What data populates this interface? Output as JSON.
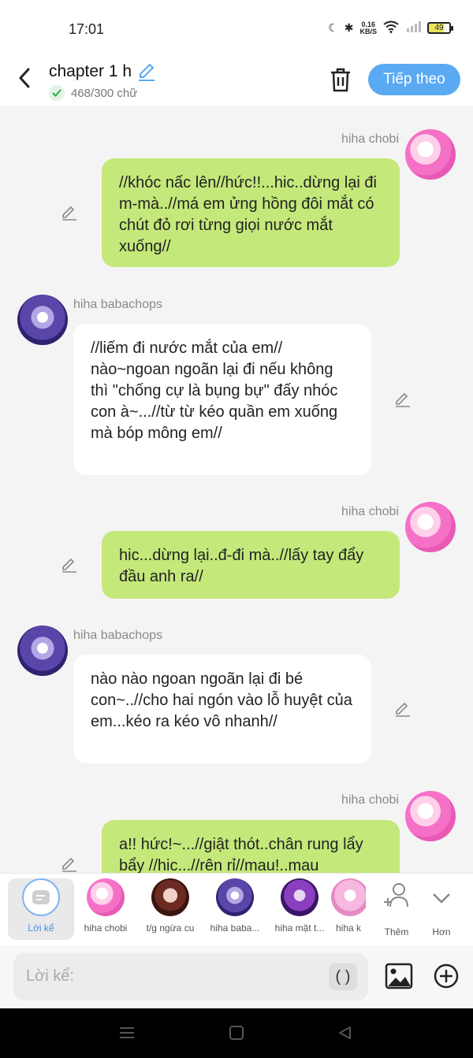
{
  "status": {
    "time": "17:01",
    "net_speed_value": "0.16",
    "net_speed_unit": "KB/S",
    "battery": "49"
  },
  "header": {
    "title": "chapter 1 h",
    "word_count": "468/300 chữ",
    "next_label": "Tiếp theo"
  },
  "messages": [
    {
      "sender": "hiha chobi",
      "side": "right",
      "text": "//khóc nấc lên//hức!!...hic..dừng lại đi m-mà..//má em ửng hồng đôi mắt có chút đỏ rơi từng giọi nước mắt xuống//"
    },
    {
      "sender": "hiha babachops",
      "side": "left",
      "text": "//liếm đi nước mắt của em// nào~ngoan ngoãn lại đi nếu không thì \"chống cự là bụng bự\" đấy nhóc con à~...//từ từ kéo quần em xuống mà bóp mông em//"
    },
    {
      "sender": "hiha chobi",
      "side": "right",
      "text": "hic...dừng lại..đ-đi mà..//lấy tay đẩy đầu anh ra//"
    },
    {
      "sender": "hiha babachops",
      "side": "left",
      "text": "nào nào ngoan ngoãn lại đi bé con~..//cho hai ngón vào lỗ huyệt của em...kéo ra kéo vô nhanh//"
    },
    {
      "sender": "hiha chobi",
      "side": "right",
      "text": "a!! hức!~...//giật thót..chân rung lẩy bẩy //hic...//rên rỉ//mau!..mau"
    }
  ],
  "characters": [
    {
      "label": "Lời kể"
    },
    {
      "label": "hiha chobi"
    },
    {
      "label": "t/g ngừa cu"
    },
    {
      "label": "hiha baba..."
    },
    {
      "label": "hiha mặt t..."
    },
    {
      "label": "hiha k"
    },
    {
      "label": "Thêm"
    },
    {
      "label": "Hơn"
    }
  ],
  "input": {
    "placeholder": "Lời kể:",
    "paren_label": "( )"
  },
  "colors": {
    "accent": "#5aa9f3",
    "bubble_self": "#c4e87a",
    "bubble_other": "#ffffff",
    "background": "#f4f4f4"
  }
}
